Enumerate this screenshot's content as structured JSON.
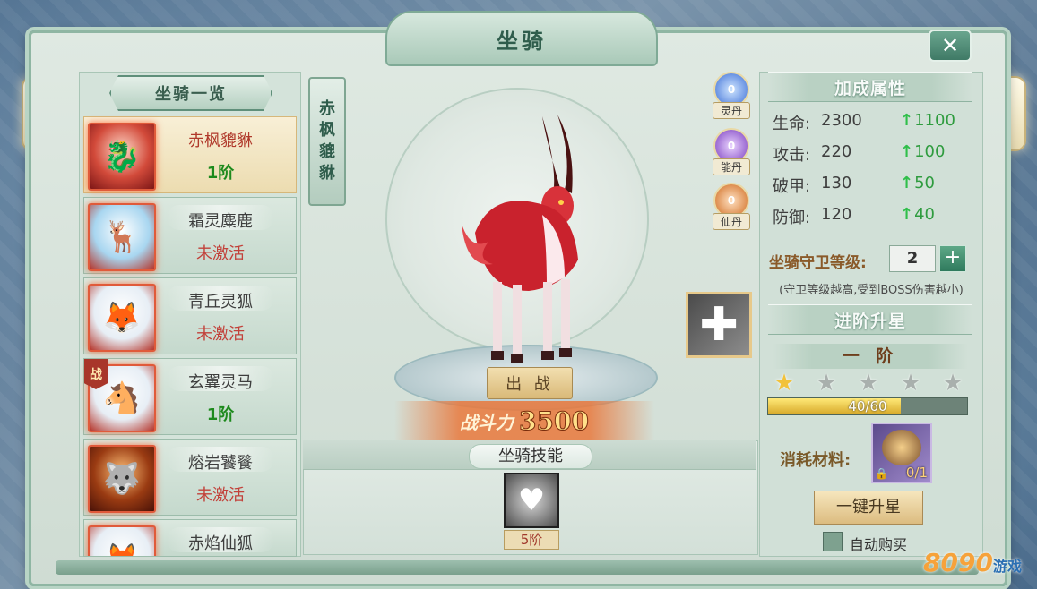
{
  "window": {
    "title": "坐骑",
    "close_label": "✕"
  },
  "mount_list": {
    "header": "坐骑一览",
    "items": [
      {
        "name": "赤枫貔貅",
        "status": "1阶",
        "state": "active",
        "battle": false
      },
      {
        "name": "霜灵麋鹿",
        "status": "未激活",
        "state": "inactive",
        "battle": false
      },
      {
        "name": "青丘灵狐",
        "status": "未激活",
        "state": "inactive",
        "battle": false
      },
      {
        "name": "玄翼灵马",
        "status": "1阶",
        "state": "owned",
        "battle": true,
        "battle_tag": "战"
      },
      {
        "name": "熔岩饕餮",
        "status": "未激活",
        "state": "inactive",
        "battle": false
      },
      {
        "name": "赤焰仙狐",
        "status": "",
        "state": "inactive",
        "battle": false
      }
    ]
  },
  "stage": {
    "mount_name_vertical": [
      "赤",
      "枫",
      "貔",
      "貅"
    ],
    "fight_button": "出 战",
    "power_label": "战斗力",
    "power_value": "3500"
  },
  "pills": [
    {
      "label": "灵丹",
      "count": "0",
      "color": "ling"
    },
    {
      "label": "能丹",
      "count": "0",
      "color": "neng"
    },
    {
      "label": "仙丹",
      "count": "0",
      "color": "xian"
    }
  ],
  "equip_slot": {
    "icon": "plus-icon",
    "symbol": "✚"
  },
  "skills": {
    "title": "坐骑技能",
    "items": [
      {
        "icon": "heart-icon",
        "symbol": "♥",
        "level": "5阶"
      }
    ]
  },
  "attributes": {
    "title": "加成属性",
    "rows": [
      {
        "label": "生命:",
        "value": "2300",
        "bonus": "1100"
      },
      {
        "label": "攻击:",
        "value": "220",
        "bonus": "100"
      },
      {
        "label": "破甲:",
        "value": "130",
        "bonus": "50"
      },
      {
        "label": "防御:",
        "value": "120",
        "bonus": "40"
      }
    ]
  },
  "guard": {
    "label": "坐骑守卫等级:",
    "level": "2",
    "plus": "+",
    "note": "(守卫等级越高,受到BOSS伤害越小)"
  },
  "advance": {
    "title": "进阶升星",
    "stage_name": "一 阶",
    "stars_total": 5,
    "stars_lit": 1,
    "progress_text": "40/60",
    "progress_fraction": 0.6667,
    "material_label": "消耗材料:",
    "material_count": "0/1",
    "upgrade_button": "一键升星",
    "auto_buy_label": "自动购买"
  },
  "watermark": {
    "text": "8090",
    "sub": "游戏"
  },
  "colors": {
    "accent": "#7faa96",
    "gold": "#d9b978",
    "power": "#ffe08a"
  }
}
